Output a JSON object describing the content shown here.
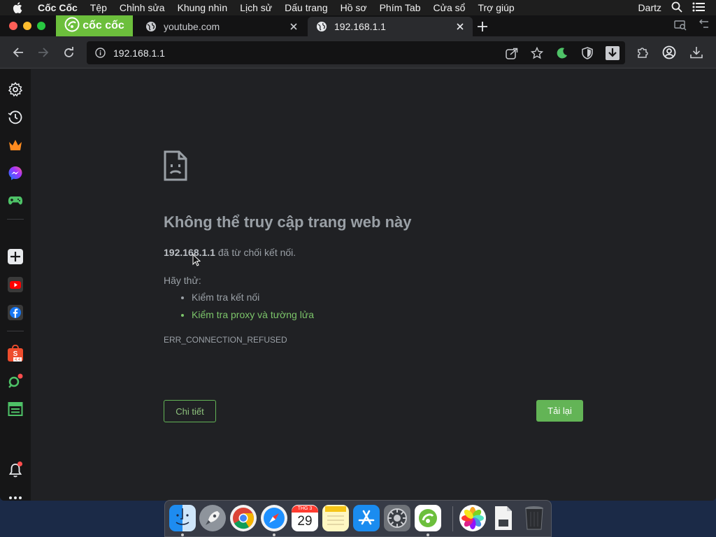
{
  "menubar": {
    "app_name": "Cốc Cốc",
    "items": [
      "Tệp",
      "Chỉnh sửa",
      "Khung nhìn",
      "Lịch sử",
      "Dấu trang",
      "Hồ sơ",
      "Phím Tab",
      "Cửa sổ",
      "Trợ giúp"
    ],
    "user": "Dartz"
  },
  "tabs": {
    "brand_label": "cốc cốc",
    "youtube_title": "youtube.com",
    "router_title": "192.168.1.1"
  },
  "toolbar": {
    "url": "192.168.1.1"
  },
  "error_page": {
    "title": "Không thể truy cập trang web này",
    "host": "192.168.1.1",
    "description": " đã từ chối kết nối.",
    "try_label": "Hãy thử:",
    "suggestions": [
      "Kiểm tra kết nối",
      "Kiểm tra proxy và tường lửa"
    ],
    "error_code": "ERR_CONNECTION_REFUSED",
    "details_button": "Chi tiết",
    "reload_button": "Tải lại"
  },
  "dock": {
    "calendar_month": "THG 3",
    "calendar_day": "29"
  },
  "colors": {
    "accent_green": "#63b456",
    "brand_green": "#6cbf3c",
    "background": "#202124"
  }
}
